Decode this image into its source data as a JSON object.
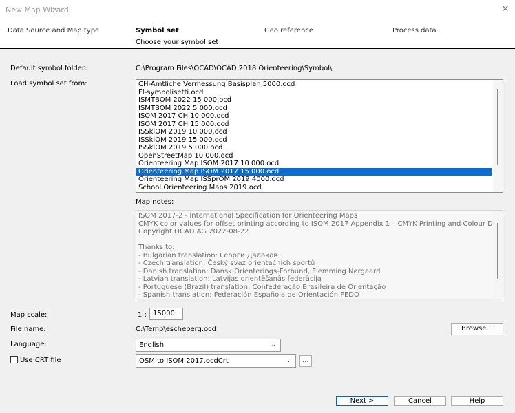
{
  "window": {
    "title": "New Map Wizard",
    "close_glyph": "✕"
  },
  "steps": [
    {
      "label": "Data Source and Map type",
      "active": false
    },
    {
      "label": "Symbol set",
      "active": true,
      "subtitle": "Choose your symbol set"
    },
    {
      "label": "Geo reference",
      "active": false
    },
    {
      "label": "Process data",
      "active": false
    }
  ],
  "default_folder": {
    "label": "Default symbol folder:",
    "value": "C:\\Program Files\\OCAD\\OCAD 2018 Orienteering\\Symbol\\"
  },
  "symbol_list": {
    "label": "Load symbol set from:",
    "items": [
      "CH-Amtliche Vermessung Basisplan 5000.ocd",
      "FI-symbolisetti.ocd",
      "ISMTBOM 2022 15 000.ocd",
      "ISMTBOM 2022 5 000.ocd",
      "ISOM 2017 CH 10 000.ocd",
      "ISOM 2017 CH 15 000.ocd",
      "ISSkiOM 2019 10 000.ocd",
      "ISSkiOM 2019 15 000.ocd",
      "ISSkiOM 2019 5 000.ocd",
      "OpenStreetMap 10 000.ocd",
      "Orienteering Map ISOM 2017 10 000.ocd",
      "Orienteering Map ISOM 2017 15 000.ocd",
      "Orienteering Map ISSprOM 2019 4000.ocd",
      "School Orienteering Maps 2019.ocd"
    ],
    "selected_index": 11
  },
  "map_notes": {
    "label": "Map notes:",
    "lines": [
      "ISOM 2017-2 - International Specification for Orienteering Maps",
      "CMYK color values for offset printing according to ISOM 2017 Appendix 1 – CMYK Printing and Colour Definitions.",
      "Copyright OCAD AG 2022-08-22",
      "",
      "Thanks to:",
      "- Bulgarian translation: Георги Далаков",
      "- Czech translation: Český svaz orientačních sportů",
      "- Danish translation: Dansk Orienterings-Forbund, Flemming Nørgaard",
      "- Latvian translation: Latvijas orientēšanās federācija",
      "- Portuguese (Brazil) translation: Confederação Brasileira de Orientação",
      "- Spanish translation: Federación Española de Orientación FEDO"
    ]
  },
  "map_scale": {
    "label": "Map scale:",
    "prefix": "1 :",
    "value": "15000"
  },
  "file_name": {
    "label": "File name:",
    "value": "C:\\Temp\\escheberg.ocd",
    "browse": "Browse..."
  },
  "language": {
    "label": "Language:",
    "value": "English"
  },
  "crt": {
    "label": "Use CRT file",
    "checked": false,
    "value": "OSM to ISOM 2017.ocdCrt",
    "ellipsis": "..."
  },
  "footer": {
    "next": "Next  >",
    "cancel": "Cancel",
    "help": "Help"
  }
}
